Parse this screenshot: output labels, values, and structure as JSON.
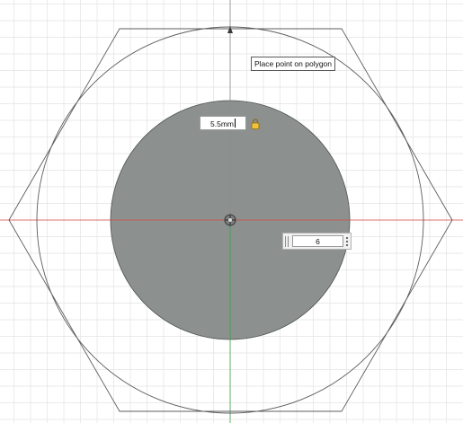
{
  "canvas": {
    "background_color": "#ffffff",
    "grid_color": "#e3e3e3",
    "x_axis_color": "#d9473c",
    "y_axis_color": "#3da34a",
    "geometry_color": "#5c5c5c",
    "fill_color": "#8c918f"
  },
  "tooltip": {
    "text": "Place point on polygon"
  },
  "diameter_dimension": {
    "value": "5.5mm",
    "lock_icon": "lock-icon"
  },
  "sides_control": {
    "value": "6",
    "grip_icon": "drag-grip-icon",
    "menu_icon": "more-dots-icon"
  },
  "origin_icon": "origin-point-icon"
}
